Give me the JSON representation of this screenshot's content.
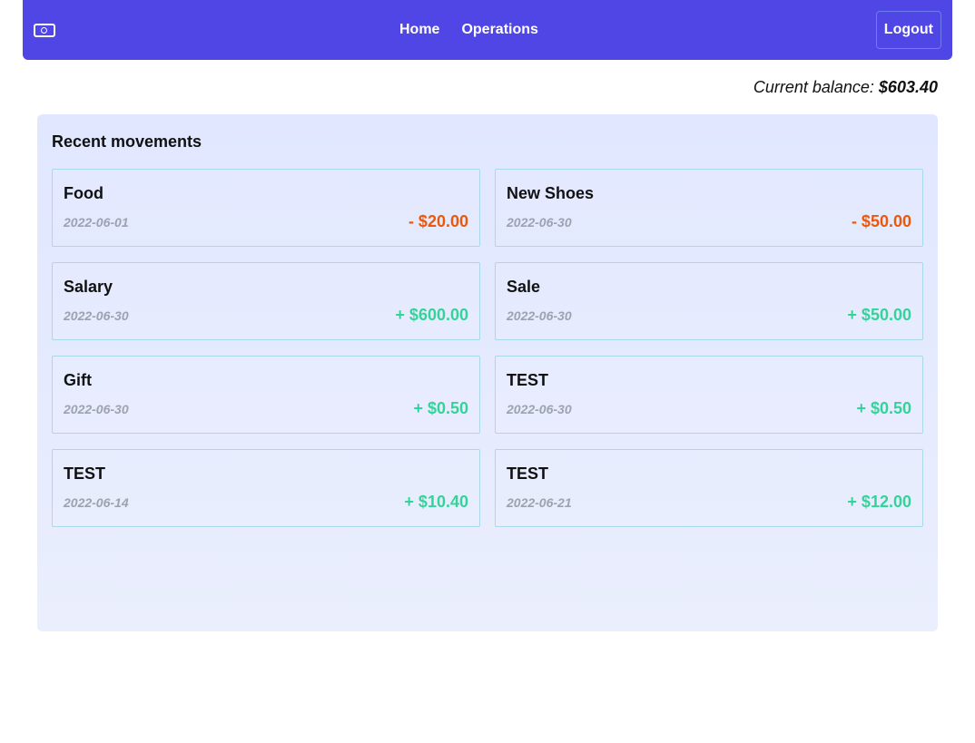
{
  "nav": {
    "links": [
      "Home",
      "Operations"
    ],
    "logout_label": "Logout"
  },
  "balance": {
    "label": "Current balance:",
    "amount": "$603.40"
  },
  "movements": {
    "title": "Recent movements",
    "items": [
      {
        "name": "Food",
        "date": "2022-06-01",
        "amount": "- $20.00",
        "type": "negative"
      },
      {
        "name": "New Shoes",
        "date": "2022-06-30",
        "amount": "- $50.00",
        "type": "negative"
      },
      {
        "name": "Salary",
        "date": "2022-06-30",
        "amount": "+ $600.00",
        "type": "positive"
      },
      {
        "name": "Sale",
        "date": "2022-06-30",
        "amount": "+ $50.00",
        "type": "positive"
      },
      {
        "name": "Gift",
        "date": "2022-06-30",
        "amount": "+ $0.50",
        "type": "positive"
      },
      {
        "name": "TEST",
        "date": "2022-06-30",
        "amount": "+ $0.50",
        "type": "positive"
      },
      {
        "name": "TEST",
        "date": "2022-06-14",
        "amount": "+ $10.40",
        "type": "positive"
      },
      {
        "name": "TEST",
        "date": "2022-06-21",
        "amount": "+ $12.00",
        "type": "positive"
      }
    ]
  },
  "colors": {
    "navbar": "#4f46e5",
    "negative": "#ea580c",
    "positive": "#34d399",
    "panel": "#e0e7ff"
  },
  "icons": {
    "logo": "money-bill-icon"
  }
}
